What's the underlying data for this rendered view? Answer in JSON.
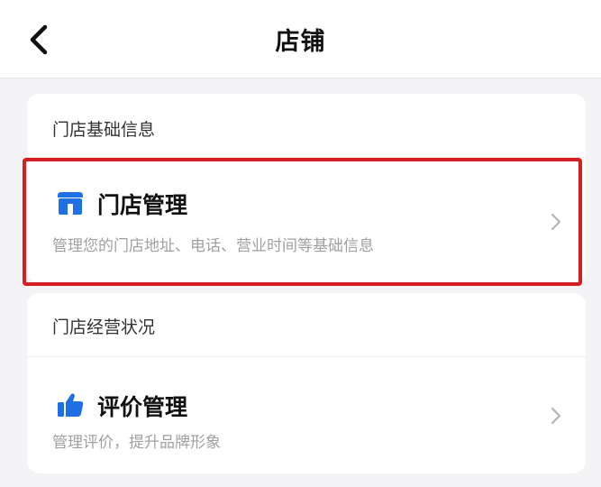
{
  "header": {
    "title": "店铺",
    "back_icon": "chevron-left-icon"
  },
  "sections": [
    {
      "title": "门店基础信息",
      "entry": {
        "icon": "store-icon",
        "title": "门店管理",
        "description": "管理您的门店地址、电话、营业时间等基础信息",
        "chevron_icon": "chevron-right-icon",
        "highlighted": true
      }
    },
    {
      "title": "门店经营状况",
      "entry": {
        "icon": "thumbs-up-icon",
        "title": "评价管理",
        "description": "管理评价，提升品牌形象",
        "chevron_icon": "chevron-right-icon",
        "highlighted": false
      }
    }
  ],
  "colors": {
    "accent_blue": "#1f6fe5",
    "highlight_red": "#d51e24",
    "page_background": "#f4f4f6",
    "secondary_text": "#a0a0a0"
  }
}
